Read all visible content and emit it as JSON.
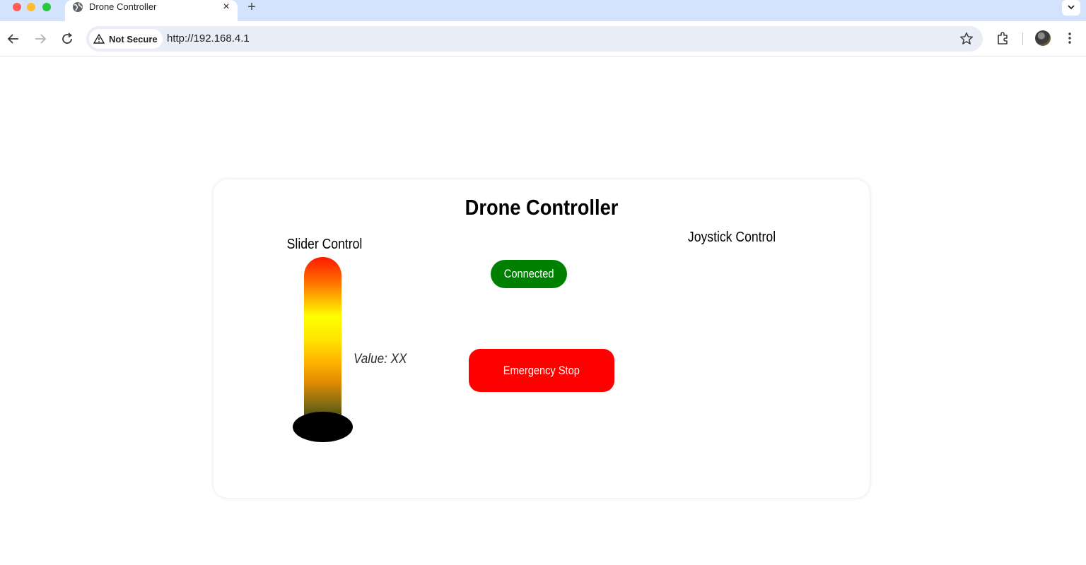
{
  "browser": {
    "tab_title": "Drone Controller",
    "tab_close": "×",
    "new_tab": "+",
    "security_label": "Not Secure",
    "url": "http://192.168.4.1"
  },
  "page": {
    "title": "Drone Controller",
    "slider_label": "Slider Control",
    "slider_value_label": "Value: XX",
    "status_label": "Connected",
    "emergency_label": "Emergency Stop",
    "joystick_label": "Joystick Control"
  },
  "colors": {
    "tabbar": "#d3e3fd",
    "status_connected": "#008000",
    "emergency": "#ff0000",
    "slider_top": "#ff1a00",
    "slider_mid": "#ffff00",
    "slider_thumb": "#000000"
  },
  "icons": {
    "tab_favicon": "globe-icon",
    "back": "arrow-left-icon",
    "forward": "arrow-right-icon",
    "reload": "reload-icon",
    "security": "warning-triangle-icon",
    "bookmark": "star-icon",
    "extensions": "puzzle-icon",
    "profile": "avatar",
    "menu": "kebab-menu-icon",
    "tab_search": "chevron-down-icon"
  }
}
